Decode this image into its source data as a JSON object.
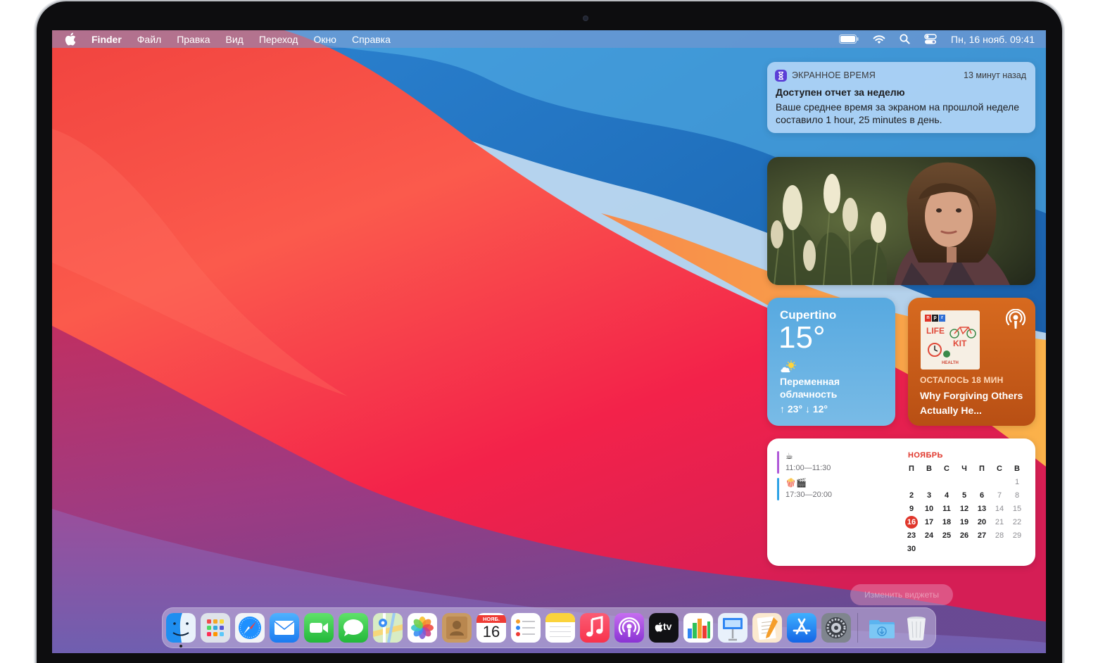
{
  "menubar": {
    "app_name": "Finder",
    "menus": [
      "Файл",
      "Правка",
      "Вид",
      "Переход",
      "Окно",
      "Справка"
    ],
    "clock": "Пн, 16 нояб.  09:41",
    "status_icons": [
      "battery-icon",
      "wifi-icon",
      "search-icon",
      "control-center-icon"
    ]
  },
  "notification": {
    "app_name": "ЭКРАННОЕ ВРЕМЯ",
    "time": "13 минут назад",
    "title": "Доступен отчет за неделю",
    "body": "Ваше среднее время за экраном на прошлой неделе составило 1 hour, 25 minutes в день."
  },
  "weather": {
    "city": "Cupertino",
    "temp": "15°",
    "condition": "Переменная облачность",
    "range": "↑ 23° ↓ 12°"
  },
  "podcast": {
    "remaining": "ОСТАЛОСЬ 18 МИН",
    "episode": "Why Forgiving Others Actually He...",
    "art_npr": [
      "n",
      "p",
      "r"
    ],
    "art_line1": "LIFE",
    "art_line2": "KIT",
    "art_footer": "HEALTH"
  },
  "calendar": {
    "events": [
      {
        "emoji": "☕",
        "time": "11:00—11:30",
        "color": "#b05ad8"
      },
      {
        "emoji": "🍿🎬",
        "time": "17:30—20:00",
        "color": "#2fa3e6"
      }
    ],
    "month": "НОЯБРЬ",
    "weekdays": [
      "П",
      "В",
      "С",
      "Ч",
      "П",
      "С",
      "В"
    ],
    "days": [
      "1",
      "2",
      "3",
      "4",
      "5",
      "6",
      "7",
      "8",
      "9",
      "10",
      "11",
      "12",
      "13",
      "14",
      "15",
      "16",
      "17",
      "18",
      "19",
      "20",
      "21",
      "22",
      "23",
      "24",
      "25",
      "26",
      "27",
      "28",
      "29",
      "30"
    ],
    "today": "16"
  },
  "ghost_button": "Изменить виджеты",
  "dock": {
    "calendar_month": "НОЯБ.",
    "calendar_day": "16",
    "appletv_label": "tv",
    "apps": [
      "finder",
      "launchpad",
      "safari",
      "mail",
      "facetime",
      "messages",
      "maps",
      "photos",
      "contacts",
      "calendar",
      "reminders",
      "notes",
      "music",
      "podcasts",
      "tv",
      "numbers",
      "keynote",
      "pages",
      "app-store",
      "system-preferences",
      "downloads",
      "trash"
    ]
  }
}
